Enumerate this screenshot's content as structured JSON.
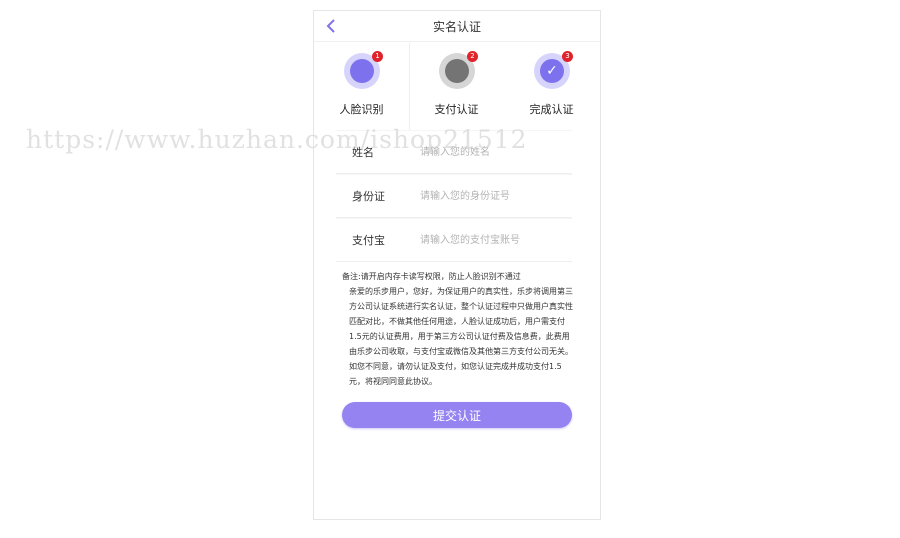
{
  "header": {
    "title": "实名认证"
  },
  "steps": [
    {
      "num": "1",
      "label": "人脸识别"
    },
    {
      "num": "2",
      "label": "支付认证"
    },
    {
      "num": "3",
      "label": "完成认证"
    }
  ],
  "form": {
    "name": {
      "label": "姓名",
      "placeholder": "请输入您的姓名"
    },
    "idcard": {
      "label": "身份证",
      "placeholder": "请输入您的身份证号"
    },
    "alipay": {
      "label": "支付宝",
      "placeholder": "请输入您的支付宝账号"
    }
  },
  "note": {
    "first": "备注:请开启内存卡读写权限，防止人脸识别不通过",
    "body": "亲爱的乐步用户，您好，为保证用户的真实性，乐步将调用第三方公司认证系统进行实名认证，整个认证过程中只做用户真实性匹配对比，不做其他任何用途，人脸认证成功后，用户需支付1.5元的认证费用，用于第三方公司认证付费及信息费，此费用由乐步公司收取，与支付宝或微信及其他第三方支付公司无关。如您不同意，请勿认证及支付，如您认证完成并成功支付1.5元，将视同同意此协议。"
  },
  "submit_label": "提交认证",
  "watermark": "https://www.huzhan.com/ishop21512",
  "colors": {
    "accent": "#7d71ee",
    "button": "#9483f0",
    "badge": "#e0232b"
  }
}
